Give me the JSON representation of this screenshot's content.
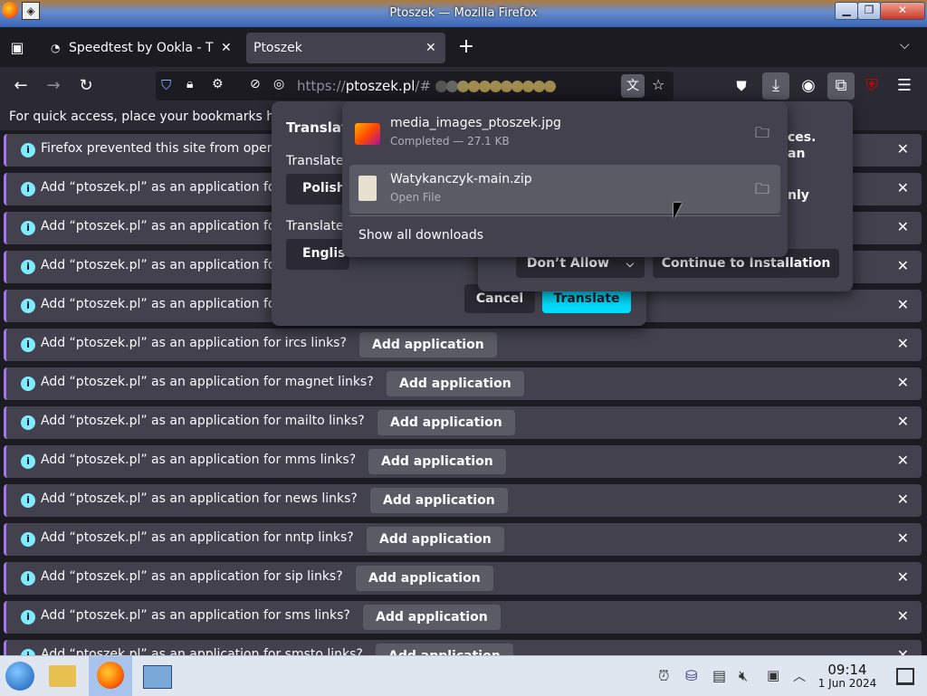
{
  "window": {
    "title": "Ptoszek — Mozilla Firefox"
  },
  "tabs": [
    {
      "label": "Speedtest by Ookla - The",
      "active": false
    },
    {
      "label": "Ptoszek",
      "active": true
    }
  ],
  "urlbar": {
    "url_prefix": "https://",
    "url_host": "ptoszek.pl",
    "url_rest": "/#"
  },
  "bookmarks_bar": {
    "text": "For quick access, place your bookmarks her"
  },
  "notifications": [
    {
      "message": "Firefox prevented this site from openin",
      "button": ""
    },
    {
      "message": "Add “ptoszek.pl” as an application for",
      "button": ""
    },
    {
      "message": "Add “ptoszek.pl” as an application for",
      "button": ""
    },
    {
      "message": "Add “ptoszek.pl” as an application for",
      "button": ""
    },
    {
      "message": "Add “ptoszek.pl” as an application for",
      "button": ""
    },
    {
      "message": "Add “ptoszek.pl” as an application for ircs links?",
      "button": "Add application"
    },
    {
      "message": "Add “ptoszek.pl” as an application for magnet links?",
      "button": "Add application"
    },
    {
      "message": "Add “ptoszek.pl” as an application for mailto links?",
      "button": "Add application"
    },
    {
      "message": "Add “ptoszek.pl” as an application for mms links?",
      "button": "Add application"
    },
    {
      "message": "Add “ptoszek.pl” as an application for news links?",
      "button": "Add application"
    },
    {
      "message": "Add “ptoszek.pl” as an application for nntp links?",
      "button": "Add application"
    },
    {
      "message": "Add “ptoszek.pl” as an application for sip links?",
      "button": "Add application"
    },
    {
      "message": "Add “ptoszek.pl” as an application for sms links?",
      "button": "Add application"
    },
    {
      "message": "Add “ptoszek.pl” as an application for smsto links?",
      "button": "Add application"
    }
  ],
  "translate_panel": {
    "title": "Translat",
    "from_label": "Translate",
    "from_value": "Polish",
    "to_label": "Translate",
    "to_value": "Englis",
    "cancel": "Cancel",
    "translate": "Translate"
  },
  "install_panel": {
    "text1": "ces.",
    "text2": "an",
    "text3": "nly",
    "dont_allow": "Don’t Allow",
    "continue": "Continue to Installation"
  },
  "downloads_panel": {
    "items": [
      {
        "name": "media_images_ptoszek.jpg",
        "status": "Completed — 27.1 KB"
      },
      {
        "name": "Watykanczyk-main.zip",
        "status": "Open File"
      }
    ],
    "show_all": "Show all downloads"
  },
  "taskbar": {
    "time": "09:14",
    "date": "1 Jun 2024"
  },
  "colors": {
    "accent": "#00ddff",
    "notif_border": "#a574f0",
    "info": "#80ebff"
  }
}
